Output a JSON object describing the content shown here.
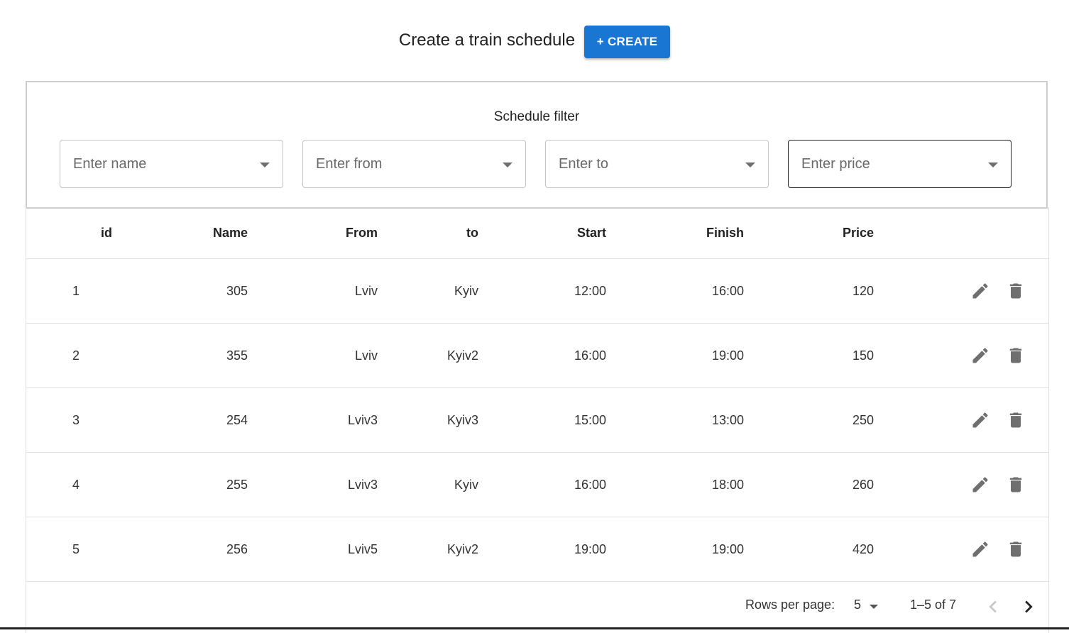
{
  "header": {
    "title": "Create a train schedule",
    "create_label": "+ CREATE"
  },
  "filter": {
    "title": "Schedule filter",
    "name_placeholder": "Enter name",
    "from_placeholder": "Enter from",
    "to_placeholder": "Enter to",
    "price_placeholder": "Enter price"
  },
  "table": {
    "headers": {
      "id": "id",
      "name": "Name",
      "from": "From",
      "to": "to",
      "start": "Start",
      "finish": "Finish",
      "price": "Price"
    },
    "rows": [
      {
        "id": "1",
        "name": "305",
        "from": "Lviv",
        "to": "Kyiv",
        "start": "12:00",
        "finish": "16:00",
        "price": "120"
      },
      {
        "id": "2",
        "name": "355",
        "from": "Lviv",
        "to": "Kyiv2",
        "start": "16:00",
        "finish": "19:00",
        "price": "150"
      },
      {
        "id": "3",
        "name": "254",
        "from": "Lviv3",
        "to": "Kyiv3",
        "start": "15:00",
        "finish": "13:00",
        "price": "250"
      },
      {
        "id": "4",
        "name": "255",
        "from": "Lviv3",
        "to": "Kyiv",
        "start": "16:00",
        "finish": "18:00",
        "price": "260"
      },
      {
        "id": "5",
        "name": "256",
        "from": "Lviv5",
        "to": "Kyiv2",
        "start": "19:00",
        "finish": "19:00",
        "price": "420"
      }
    ]
  },
  "pagination": {
    "rows_per_page_label": "Rows per page:",
    "rows_per_page": "5",
    "range": "1–5 of 7"
  },
  "colors": {
    "primary": "#1976d2",
    "icon": "#6f6f6f",
    "border": "#e0e0e0"
  },
  "icons": {
    "edit": "pencil-icon",
    "delete": "trash-icon",
    "prev": "chevron-left-icon",
    "next": "chevron-right-icon"
  }
}
